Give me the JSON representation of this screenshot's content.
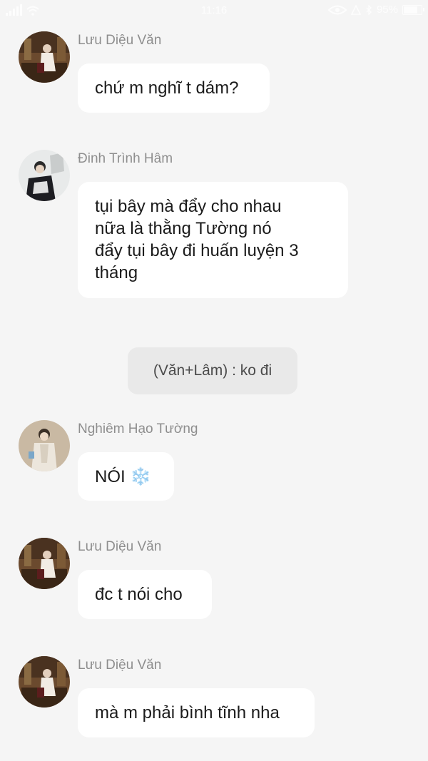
{
  "status_bar": {
    "time": "11:16",
    "battery": "95%"
  },
  "messages": [
    {
      "sender": "Lưu Diệu Văn",
      "lines": [
        "chứ m nghĩ t dám?"
      ]
    },
    {
      "sender": "Đinh Trình Hâm",
      "lines": [
        "tụi bây mà đẩy cho nhau",
        "nữa là thằng Tường nó",
        "đẩy tụi bây đi huấn luyện 3",
        "tháng"
      ]
    },
    {
      "sender": "Nghiêm Hạo Tường",
      "text": "NÓI",
      "emoji": "❄️"
    },
    {
      "sender": "Lưu Diệu Văn",
      "lines": [
        "đc t nói cho"
      ]
    },
    {
      "sender": "Lưu Diệu Văn",
      "lines": [
        "mà m phải bình tĩnh nha"
      ]
    }
  ],
  "system_message": "(Văn+Lâm) : ko đi",
  "avatars": {
    "luu_dieu_van": "avatar-photo-seated-man-ornate-room",
    "dinh_trinh_ham": "avatar-photo-man-dark-jacket",
    "nghiem_hao_tuong": "avatar-photo-man-light-suit"
  },
  "colors": {
    "background": "#f5f5f5",
    "bubble": "#ffffff",
    "sender_name": "#8e8e8e",
    "system_pill": "#e9e9e9"
  }
}
